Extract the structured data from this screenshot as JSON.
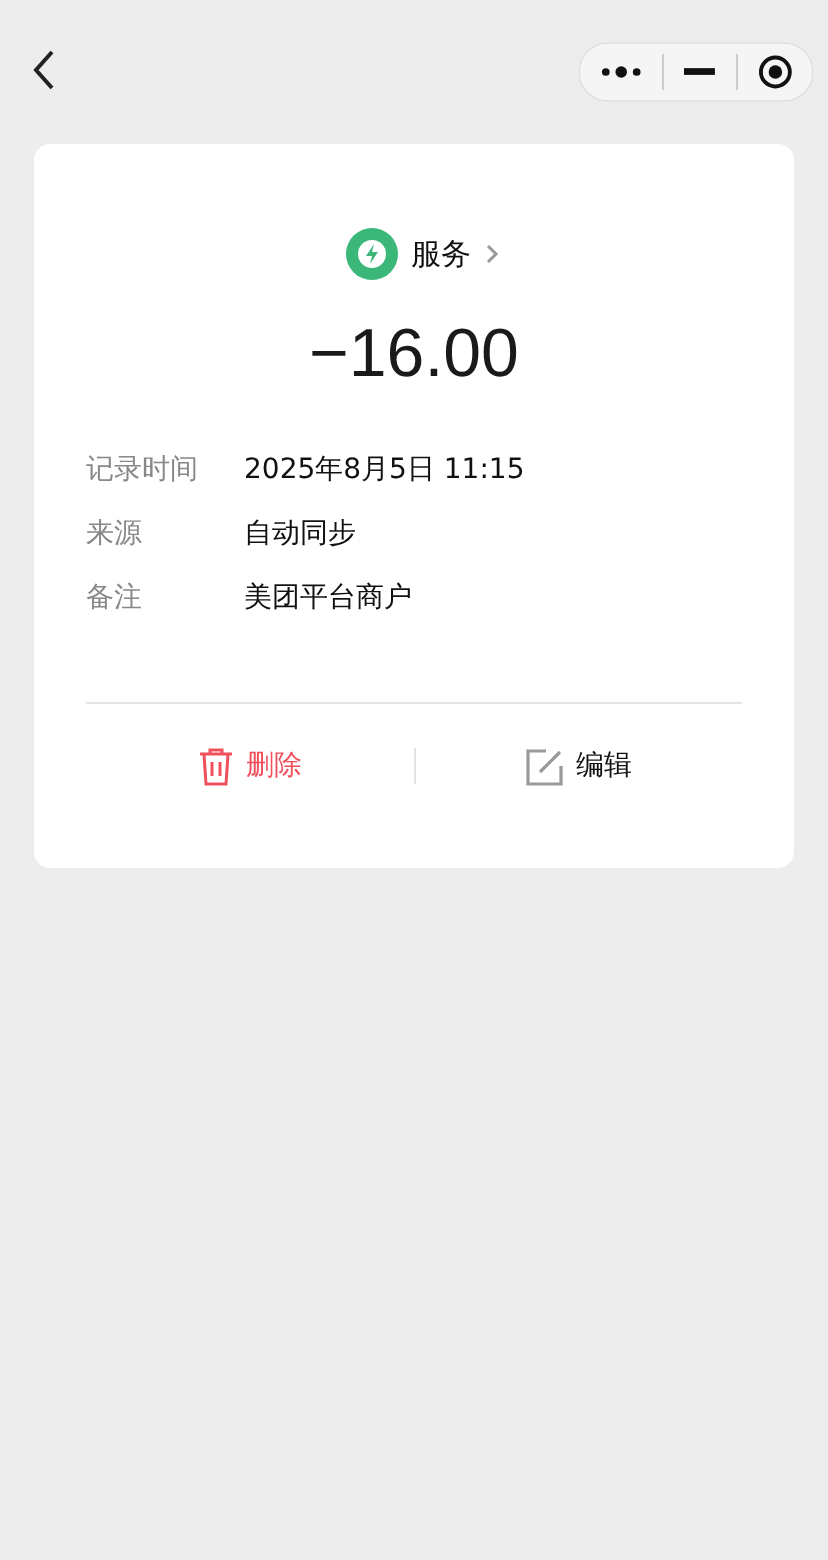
{
  "category": {
    "label": "服务"
  },
  "amount": "−16.00",
  "details": [
    {
      "label": "记录时间",
      "value": "2025年8月5日 11:15"
    },
    {
      "label": "来源",
      "value": "自动同步"
    },
    {
      "label": "备注",
      "value": "美团平台商户"
    }
  ],
  "actions": [
    {
      "kind": "delete",
      "label": "删除"
    },
    {
      "kind": "edit",
      "label": "编辑"
    }
  ]
}
